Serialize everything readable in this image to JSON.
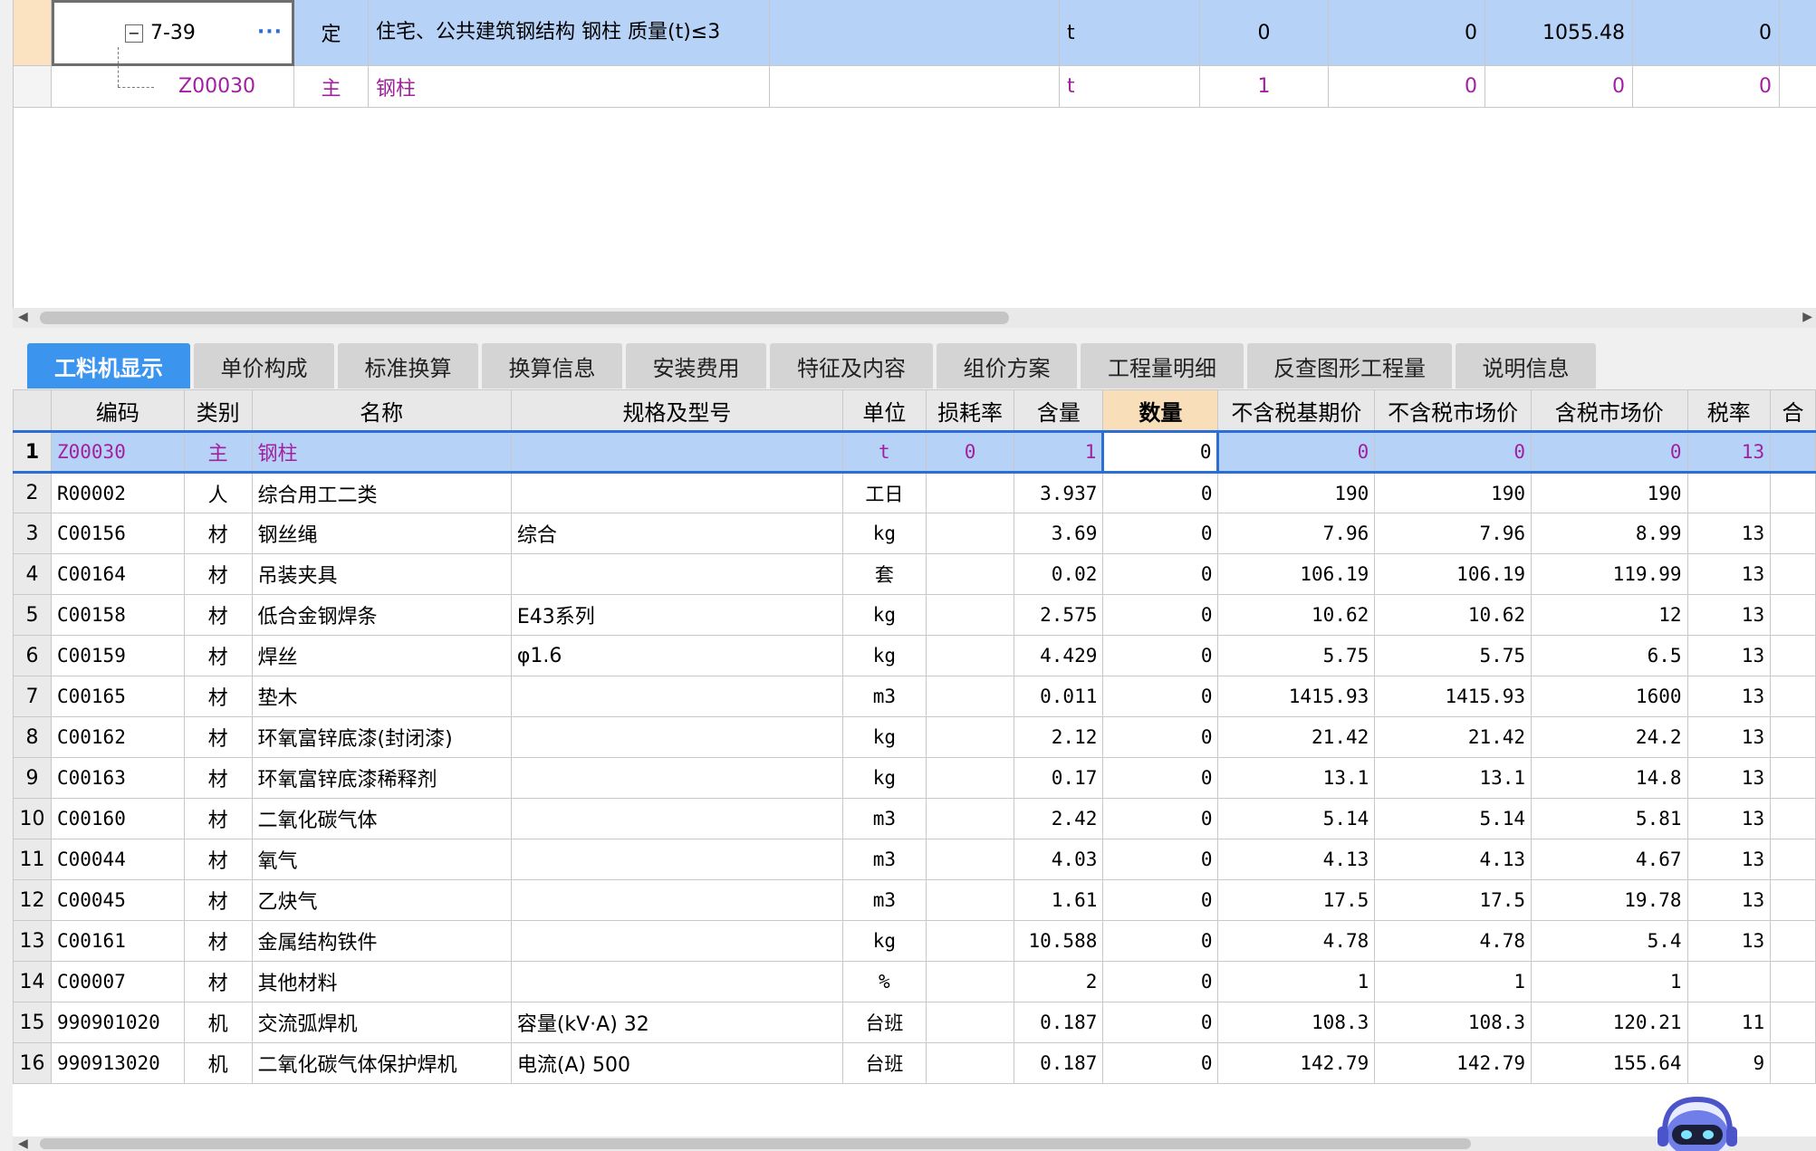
{
  "top_grid": {
    "row_a": {
      "code": "7-39",
      "type": "定",
      "name": "住宅、公共建筑钢结构 钢柱 质量(t)≤3",
      "unit": "t",
      "c1": "0",
      "c2": "0",
      "c3": "1055.48",
      "c4": "0",
      "ellipsis": "···"
    },
    "row_b": {
      "code": "Z00030",
      "type": "主",
      "name": "钢柱",
      "unit": "t",
      "c1": "1",
      "c2": "0",
      "c3": "0",
      "c4": "0"
    }
  },
  "tabs": [
    {
      "label": "工料机显示",
      "active": true
    },
    {
      "label": "单价构成"
    },
    {
      "label": "标准换算"
    },
    {
      "label": "换算信息"
    },
    {
      "label": "安装费用"
    },
    {
      "label": "特征及内容"
    },
    {
      "label": "组价方案"
    },
    {
      "label": "工程量明细"
    },
    {
      "label": "反查图形工程量"
    },
    {
      "label": "说明信息"
    }
  ],
  "columns": [
    "编码",
    "类别",
    "名称",
    "规格及型号",
    "单位",
    "损耗率",
    "含量",
    "数量",
    "不含税基期价",
    "不含税市场价",
    "含税市场价",
    "税率",
    "合"
  ],
  "rows": [
    [
      "1",
      "Z00030",
      "主",
      "钢柱",
      "",
      "t",
      "0",
      "1",
      "0",
      "0",
      "0",
      "0",
      "13"
    ],
    [
      "2",
      "R00002",
      "人",
      "综合用工二类",
      "",
      "工日",
      "",
      "3.937",
      "0",
      "190",
      "190",
      "190",
      ""
    ],
    [
      "3",
      "C00156",
      "材",
      "钢丝绳",
      "综合",
      "kg",
      "",
      "3.69",
      "0",
      "7.96",
      "7.96",
      "8.99",
      "13"
    ],
    [
      "4",
      "C00164",
      "材",
      "吊装夹具",
      "",
      "套",
      "",
      "0.02",
      "0",
      "106.19",
      "106.19",
      "119.99",
      "13"
    ],
    [
      "5",
      "C00158",
      "材",
      "低合金钢焊条",
      "E43系列",
      "kg",
      "",
      "2.575",
      "0",
      "10.62",
      "10.62",
      "12",
      "13"
    ],
    [
      "6",
      "C00159",
      "材",
      "焊丝",
      "φ1.6",
      "kg",
      "",
      "4.429",
      "0",
      "5.75",
      "5.75",
      "6.5",
      "13"
    ],
    [
      "7",
      "C00165",
      "材",
      "垫木",
      "",
      "m3",
      "",
      "0.011",
      "0",
      "1415.93",
      "1415.93",
      "1600",
      "13"
    ],
    [
      "8",
      "C00162",
      "材",
      "环氧富锌底漆(封闭漆)",
      "",
      "kg",
      "",
      "2.12",
      "0",
      "21.42",
      "21.42",
      "24.2",
      "13"
    ],
    [
      "9",
      "C00163",
      "材",
      "环氧富锌底漆稀释剂",
      "",
      "kg",
      "",
      "0.17",
      "0",
      "13.1",
      "13.1",
      "14.8",
      "13"
    ],
    [
      "10",
      "C00160",
      "材",
      "二氧化碳气体",
      "",
      "m3",
      "",
      "2.42",
      "0",
      "5.14",
      "5.14",
      "5.81",
      "13"
    ],
    [
      "11",
      "C00044",
      "材",
      "氧气",
      "",
      "m3",
      "",
      "4.03",
      "0",
      "4.13",
      "4.13",
      "4.67",
      "13"
    ],
    [
      "12",
      "C00045",
      "材",
      "乙炔气",
      "",
      "m3",
      "",
      "1.61",
      "0",
      "17.5",
      "17.5",
      "19.78",
      "13"
    ],
    [
      "13",
      "C00161",
      "材",
      "金属结构铁件",
      "",
      "kg",
      "",
      "10.588",
      "0",
      "4.78",
      "4.78",
      "5.4",
      "13"
    ],
    [
      "14",
      "C00007",
      "材",
      "其他材料",
      "",
      "%",
      "",
      "2",
      "0",
      "1",
      "1",
      "1",
      ""
    ],
    [
      "15",
      "990901020",
      "机",
      "交流弧焊机",
      "容量(kV·A) 32",
      "台班",
      "",
      "0.187",
      "0",
      "108.3",
      "108.3",
      "120.21",
      "11"
    ],
    [
      "16",
      "990913020",
      "机",
      "二氧化碳气体保护焊机",
      "电流(A) 500",
      "台班",
      "",
      "0.187",
      "0",
      "142.79",
      "142.79",
      "155.64",
      "9"
    ]
  ]
}
